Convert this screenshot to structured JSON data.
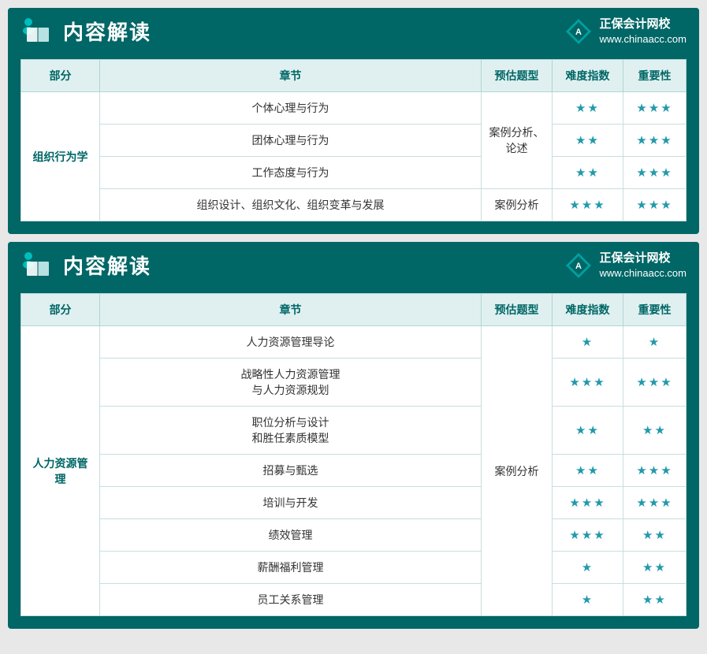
{
  "sections": [
    {
      "id": "section1",
      "title": "内容解读",
      "logo": {
        "name": "正保会计网校",
        "url": "www.chinaacc.com"
      },
      "table": {
        "headers": [
          "部分",
          "章节",
          "预估题型",
          "难度指数",
          "重要性"
        ],
        "rows": [
          {
            "part": "组织行为学",
            "part_rowspan": 4,
            "chapters": [
              {
                "name": "个体心理与行为",
                "type": "案例分析、\n论述",
                "type_rowspan": 3,
                "difficulty": "★★",
                "importance": "★★★"
              },
              {
                "name": "团体心理与行为",
                "type": "",
                "difficulty": "★★",
                "importance": "★★★"
              },
              {
                "name": "工作态度与行为",
                "type": "",
                "difficulty": "★★",
                "importance": "★★★"
              },
              {
                "name": "组织设计、组织文化、组织变革与发展",
                "type": "案例分析",
                "type_rowspan": 1,
                "difficulty": "★★★",
                "importance": "★★★"
              }
            ]
          }
        ]
      }
    },
    {
      "id": "section2",
      "title": "内容解读",
      "logo": {
        "name": "正保会计网校",
        "url": "www.chinaacc.com"
      },
      "table": {
        "headers": [
          "部分",
          "章节",
          "预估题型",
          "难度指数",
          "重要性"
        ],
        "rows": [
          {
            "part": "人力资源管理",
            "part_rowspan": 8,
            "chapters": [
              {
                "name": "人力资源管理导论",
                "type": "案例分析",
                "type_rowspan": 8,
                "difficulty": "★",
                "importance": "★"
              },
              {
                "name": "战略性人力资源管理\n与人力资源规划",
                "type": "",
                "difficulty": "★★★",
                "importance": "★★★"
              },
              {
                "name": "职位分析与设计\n和胜任素质模型",
                "type": "",
                "difficulty": "★★",
                "importance": "★★"
              },
              {
                "name": "招募与甄选",
                "type": "",
                "difficulty": "★★",
                "importance": "★★★"
              },
              {
                "name": "培训与开发",
                "type": "",
                "difficulty": "★★★",
                "importance": "★★★"
              },
              {
                "name": "绩效管理",
                "type": "",
                "difficulty": "★★★",
                "importance": "★★"
              },
              {
                "name": "薪酬福利管理",
                "type": "",
                "difficulty": "★",
                "importance": "★★"
              },
              {
                "name": "员工关系管理",
                "type": "",
                "difficulty": "★",
                "importance": "★★"
              }
            ]
          }
        ]
      }
    }
  ]
}
